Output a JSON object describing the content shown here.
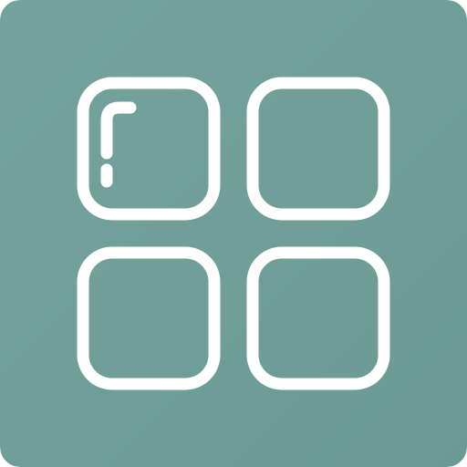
{
  "app_icon": {
    "icon_name": "grid-four-squares-icon",
    "colors": {
      "background": "#6b9a94",
      "background_highlight": "#74a39d",
      "stroke": "#ffffff"
    }
  }
}
